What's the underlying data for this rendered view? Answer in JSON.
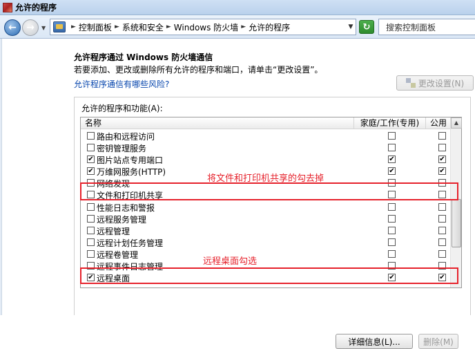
{
  "window": {
    "title": "允许的程序"
  },
  "address": {
    "breadcrumbs": [
      "控制面板",
      "系统和安全",
      "Windows 防火墙",
      "允许的程序"
    ],
    "search_placeholder": "搜索控制面板"
  },
  "page": {
    "heading": "允许程序通过 Windows 防火墙通信",
    "description": "若要添加、更改或删除所有允许的程序和端口，请单击“更改设置”。",
    "risk_link": "允许程序通信有哪些风险?",
    "change_settings_label": "更改设置(N)"
  },
  "programs": {
    "group_label": "允许的程序和功能(A):",
    "columns": {
      "name": "名称",
      "home": "家庭/工作(专用)",
      "public": "公用"
    },
    "rows": [
      {
        "label": "路由和远程访问",
        "enabled": "",
        "home": "",
        "public": ""
      },
      {
        "label": "密钥管理服务",
        "enabled": "",
        "home": "",
        "public": ""
      },
      {
        "label": "图片站点专用端口",
        "enabled": "✔",
        "home": "✔",
        "public": "✔"
      },
      {
        "label": "万维网服务(HTTP)",
        "enabled": "✔",
        "home": "✔",
        "public": "✔"
      },
      {
        "label": "网络发现",
        "enabled": "",
        "home": "",
        "public": ""
      },
      {
        "label": "文件和打印机共享",
        "enabled": "",
        "home": "",
        "public": ""
      },
      {
        "label": "性能日志和警报",
        "enabled": "",
        "home": "",
        "public": ""
      },
      {
        "label": "远程服务管理",
        "enabled": "",
        "home": "",
        "public": ""
      },
      {
        "label": "远程管理",
        "enabled": "",
        "home": "",
        "public": ""
      },
      {
        "label": "远程计划任务管理",
        "enabled": "",
        "home": "",
        "public": ""
      },
      {
        "label": "远程卷管理",
        "enabled": "",
        "home": "",
        "public": ""
      },
      {
        "label": "远程事件日志管理",
        "enabled": "",
        "home": "",
        "public": ""
      },
      {
        "label": "远程桌面",
        "enabled": "✔",
        "home": "✔",
        "public": "✔"
      }
    ],
    "details_label": "详细信息(L)...",
    "delete_label": "删除(M)"
  },
  "annotations": {
    "file_sharing_note": "将文件和打印机共享的勾去掉",
    "remote_desktop_note": "远程桌面勾选",
    "color": "#e6212b"
  }
}
